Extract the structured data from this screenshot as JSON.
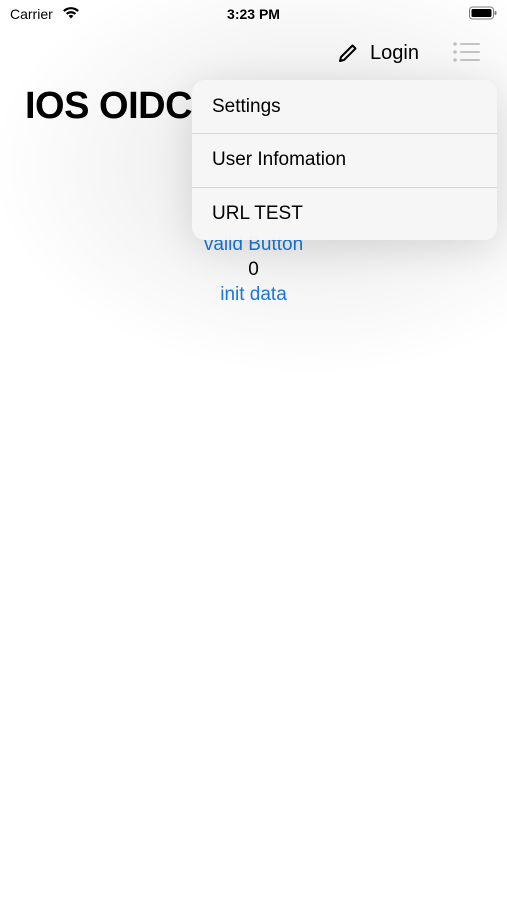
{
  "status_bar": {
    "carrier": "Carrier",
    "time": "3:23 PM"
  },
  "nav": {
    "login_label": "Login",
    "login_icon": "pencil-icon",
    "menu_icon": "list-icon"
  },
  "title": "IOS OIDC",
  "content": {
    "valid_button": "valid Button",
    "count": "0",
    "init_data": "init data"
  },
  "menu": {
    "items": [
      {
        "label": "Settings"
      },
      {
        "label": "User Infomation"
      },
      {
        "label": "URL TEST"
      }
    ]
  },
  "colors": {
    "link": "#1a7ce2",
    "menu_bg": "#f6f6f6",
    "separator": "#d6d6d8"
  }
}
